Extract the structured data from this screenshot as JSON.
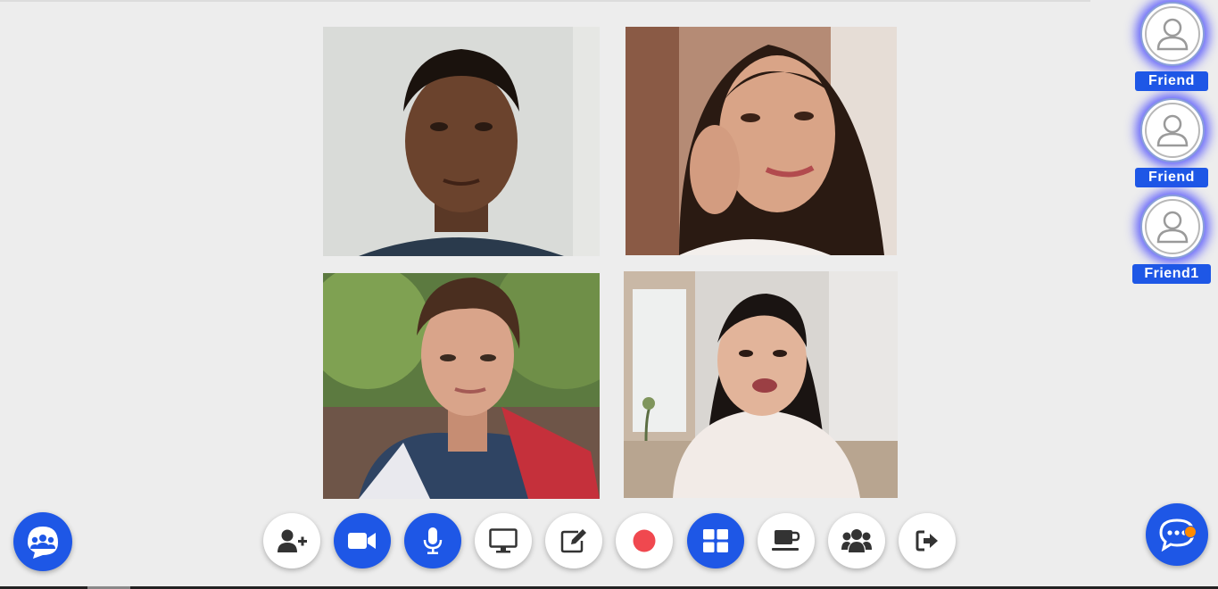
{
  "participants": [
    {
      "name": "Friend",
      "icon": "user-avatar-icon"
    },
    {
      "name": "Friend",
      "icon": "user-avatar-icon"
    },
    {
      "name": "Friend1",
      "icon": "user-avatar-icon"
    }
  ],
  "video_tiles": [
    {
      "id": "tile-1",
      "description_icon": "video-feed"
    },
    {
      "id": "tile-2",
      "description_icon": "video-feed"
    },
    {
      "id": "tile-3",
      "description_icon": "video-feed"
    },
    {
      "id": "tile-4",
      "description_icon": "video-feed"
    }
  ],
  "controls": [
    {
      "icon": "add-user-icon",
      "active": false
    },
    {
      "icon": "camera-icon",
      "active": true
    },
    {
      "icon": "microphone-icon",
      "active": true
    },
    {
      "icon": "screen-share-icon",
      "active": false
    },
    {
      "icon": "whiteboard-edit-icon",
      "active": false
    },
    {
      "icon": "record-icon",
      "active": false
    },
    {
      "icon": "grid-layout-icon",
      "active": true
    },
    {
      "icon": "coffee-break-icon",
      "active": false
    },
    {
      "icon": "participants-icon",
      "active": false
    },
    {
      "icon": "leave-icon",
      "active": false
    }
  ],
  "colors": {
    "accent": "#1e57e6",
    "record": "#f0484f",
    "notification": "#ff8a00",
    "background": "#ededed"
  }
}
